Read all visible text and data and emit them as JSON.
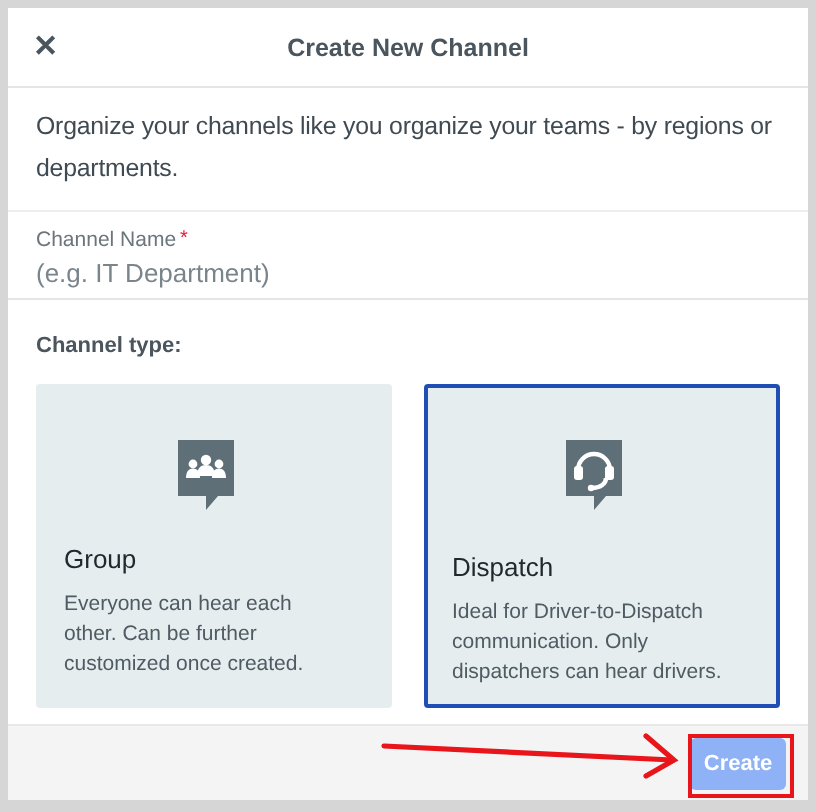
{
  "dialog": {
    "close_icon": "✕",
    "title": "Create New Channel"
  },
  "description": "Organize your channels like you organize your teams - by regions or departments.",
  "channel_name": {
    "label": "Channel Name",
    "required_mark": "*",
    "placeholder": "(e.g. IT Department)"
  },
  "channel_type": {
    "label": "Channel type:",
    "options": [
      {
        "kind": "group",
        "title": "Group",
        "description": "Everyone can hear each other. Can be further customized once created.",
        "selected": false
      },
      {
        "kind": "dispatch",
        "title": "Dispatch",
        "description": "Ideal for Driver-to-Dispatch communication. Only dispatchers can hear drivers.",
        "selected": true
      }
    ]
  },
  "footer": {
    "create_button": {
      "label": "Create",
      "disabled": true
    }
  },
  "annotation": {
    "arrow": true,
    "highlight": true
  }
}
